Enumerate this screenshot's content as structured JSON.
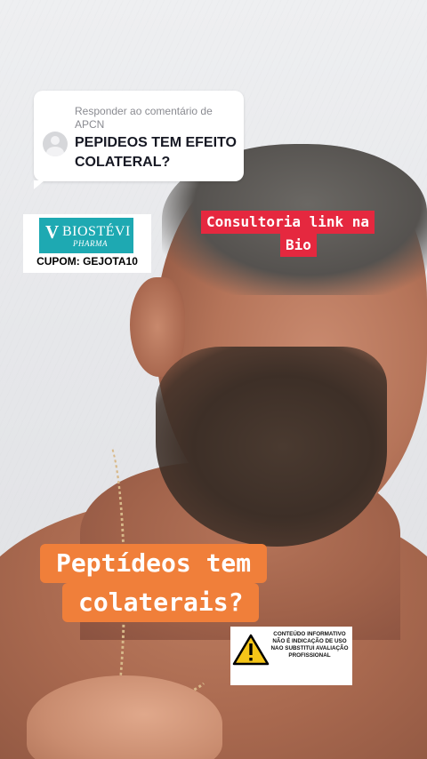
{
  "reply": {
    "header": "Responder ao comentário de APCN",
    "question": "PEPIDEOS TEM EFEITO COLATERAL?"
  },
  "sponsor": {
    "logo_mark": "V",
    "logo_name": "BIOSTÉVI",
    "logo_sub": "PHARMA",
    "coupon": "CUPOM: GEJOTA10",
    "brand_color": "#1ea9b2"
  },
  "consult": {
    "lines": [
      "Consultoria link na",
      "Bio"
    ],
    "color": "#e5283f"
  },
  "title": {
    "lines": [
      "Peptídeos tem",
      "colaterais?"
    ],
    "color": "#f07f3a"
  },
  "disclaimer": {
    "icon": "warning-triangle-icon",
    "text": "CONTEÚDO INFORMATIVO NÃO É INDICAÇÃO DE USO NAO SUBSTITUI AVALIAÇÃO PROFISSIONAL"
  }
}
